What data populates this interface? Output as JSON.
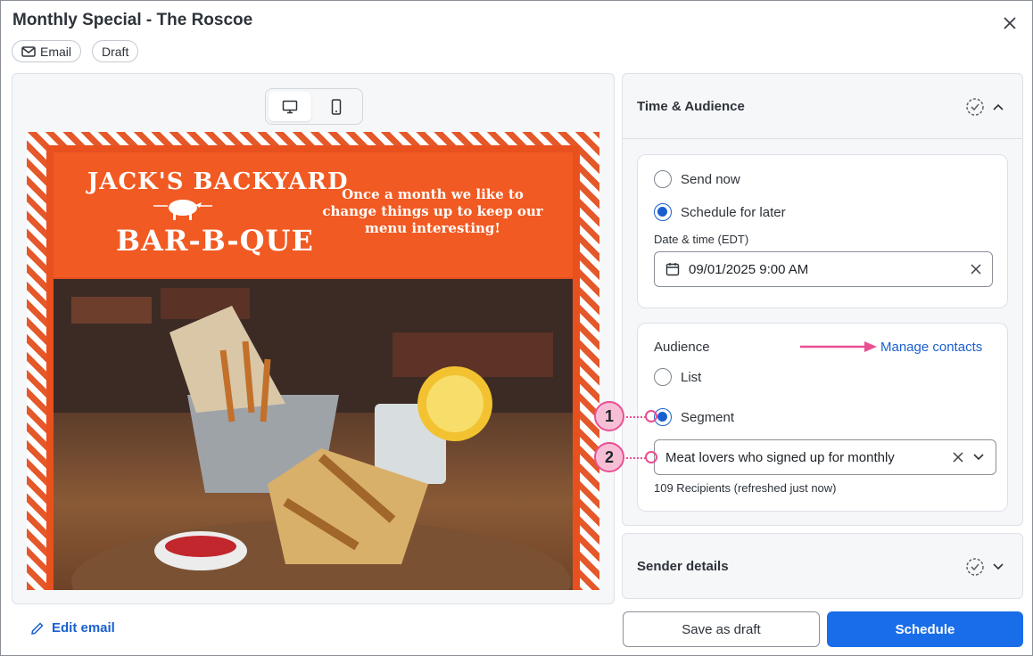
{
  "window": {
    "title": "Monthly Special - The Roscoe",
    "tags": [
      "Email",
      "Draft"
    ]
  },
  "preview": {
    "logo_top": "JACK'S BACKYARD",
    "logo_bottom": "BAR-B-QUE",
    "tagline": "Once a month we like to change things up to keep our menu interesting!",
    "edit_label": "Edit email"
  },
  "time_audience": {
    "title": "Time & Audience",
    "send_now_label": "Send now",
    "schedule_later_label": "Schedule for later",
    "datetime_label": "Date & time (EDT)",
    "datetime_value": "09/01/2025 9:00 AM"
  },
  "audience": {
    "label": "Audience",
    "manage_link": "Manage contacts",
    "list_label": "List",
    "segment_label": "Segment",
    "segment_value": "Meat lovers who signed up for monthly",
    "recipients": "109 Recipients (refreshed just now)"
  },
  "sender": {
    "title": "Sender details"
  },
  "footer": {
    "save_draft": "Save as draft",
    "schedule": "Schedule"
  },
  "callouts": [
    "1",
    "2"
  ],
  "colors": {
    "accent": "#1a6de8",
    "callout": "#e94f92",
    "brand_orange": "#f15a22"
  }
}
